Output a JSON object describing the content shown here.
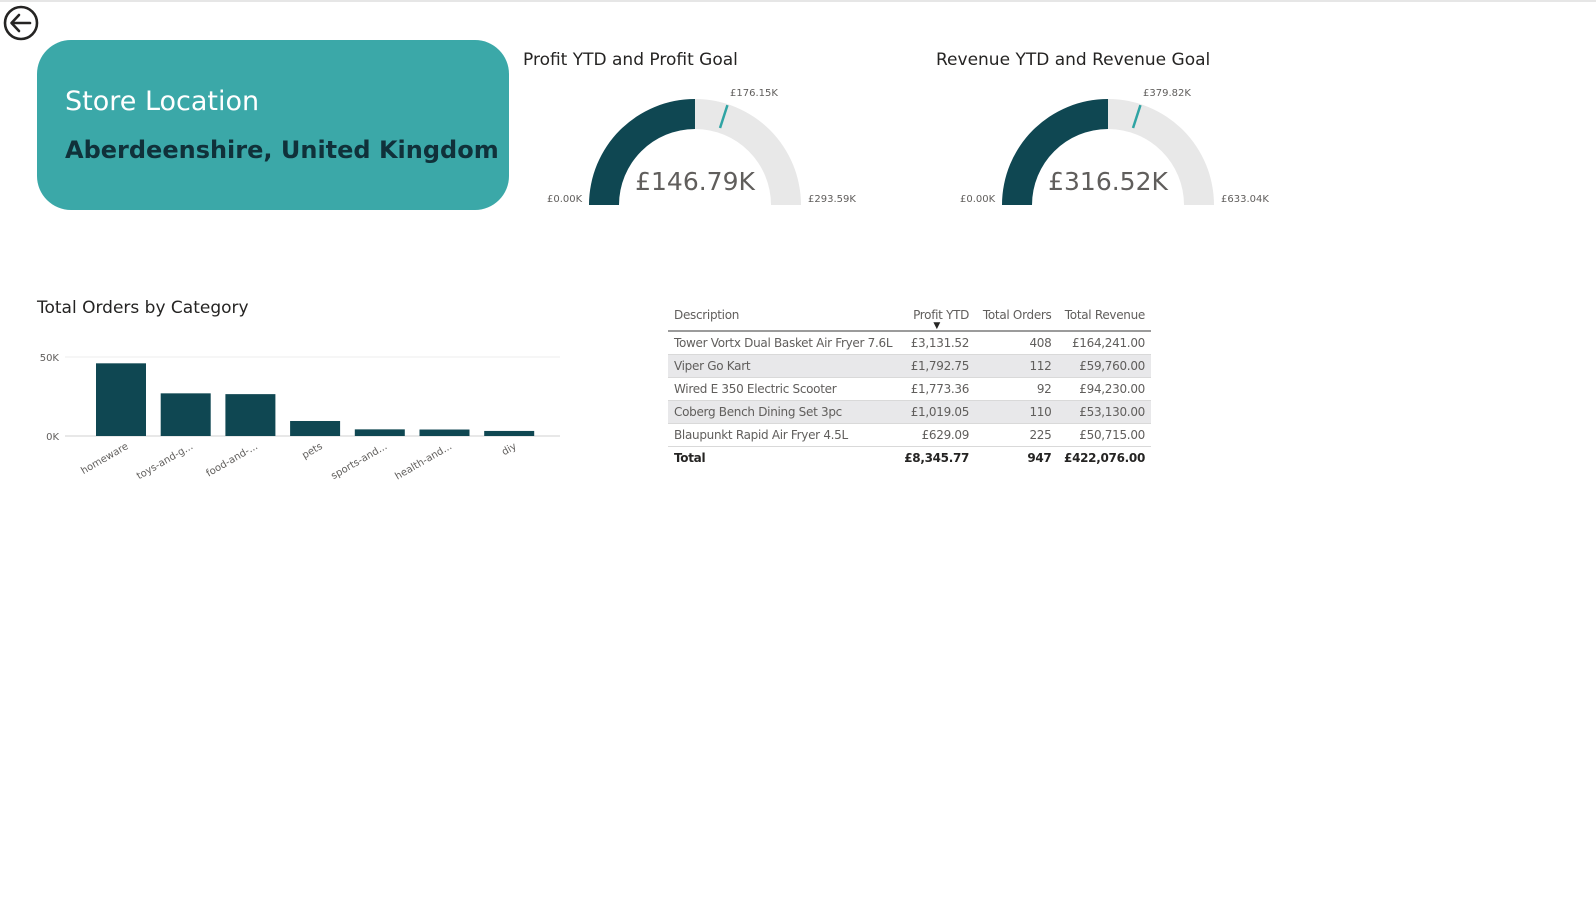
{
  "colors": {
    "accent": "#3ba8a8",
    "dark_teal": "#0f4752",
    "gauge_track": "#e8e8e8",
    "target_marker": "#2fa4a4"
  },
  "nav": {
    "back_icon": "back-arrow-icon"
  },
  "store_card": {
    "title": "Store Location",
    "value": "Aberdeenshire, United Kingdom"
  },
  "profit_gauge": {
    "title": "Profit YTD and Profit Goal",
    "value_label": "£146.79K",
    "min_label": "£0.00K",
    "max_label": "£293.59K",
    "target_label": "£176.15K",
    "value": 146.79,
    "min": 0,
    "max": 293.59,
    "target": 176.15
  },
  "revenue_gauge": {
    "title": "Revenue YTD and Revenue Goal",
    "value_label": "£316.52K",
    "min_label": "£0.00K",
    "max_label": "£633.04K",
    "target_label": "£379.82K",
    "value": 316.52,
    "min": 0,
    "max": 633.04,
    "target": 379.82
  },
  "chart_data": {
    "type": "bar",
    "title": "Total Orders by Category",
    "xlabel": "",
    "ylabel": "",
    "categories": [
      "homeware",
      "toys-and-g...",
      "food-and-...",
      "pets",
      "sports-and...",
      "health-and...",
      "diy"
    ],
    "values": [
      46000,
      27000,
      26500,
      9500,
      4200,
      4100,
      3200
    ],
    "ylim": [
      0,
      50000
    ],
    "yticks": [
      {
        "value": 50000,
        "label": "50K"
      },
      {
        "value": 0,
        "label": "0K"
      }
    ],
    "grid": true,
    "legend": "none"
  },
  "table": {
    "headers": [
      "Description",
      "Profit YTD",
      "Total Orders",
      "Total Revenue"
    ],
    "sorted_column": "Profit YTD",
    "rows": [
      [
        "Tower Vortx Dual Basket Air Fryer 7.6L",
        "£3,131.52",
        "408",
        "£164,241.00"
      ],
      [
        "Viper Go Kart",
        "£1,792.75",
        "112",
        "£59,760.00"
      ],
      [
        "Wired E 350 Electric Scooter",
        "£1,773.36",
        "92",
        "£94,230.00"
      ],
      [
        "Coberg Bench Dining Set 3pc",
        "£1,019.05",
        "110",
        "£53,130.00"
      ],
      [
        "Blaupunkt Rapid Air Fryer 4.5L",
        "£629.09",
        "225",
        "£50,715.00"
      ]
    ],
    "total": [
      "Total",
      "£8,345.77",
      "947",
      "£422,076.00"
    ]
  }
}
